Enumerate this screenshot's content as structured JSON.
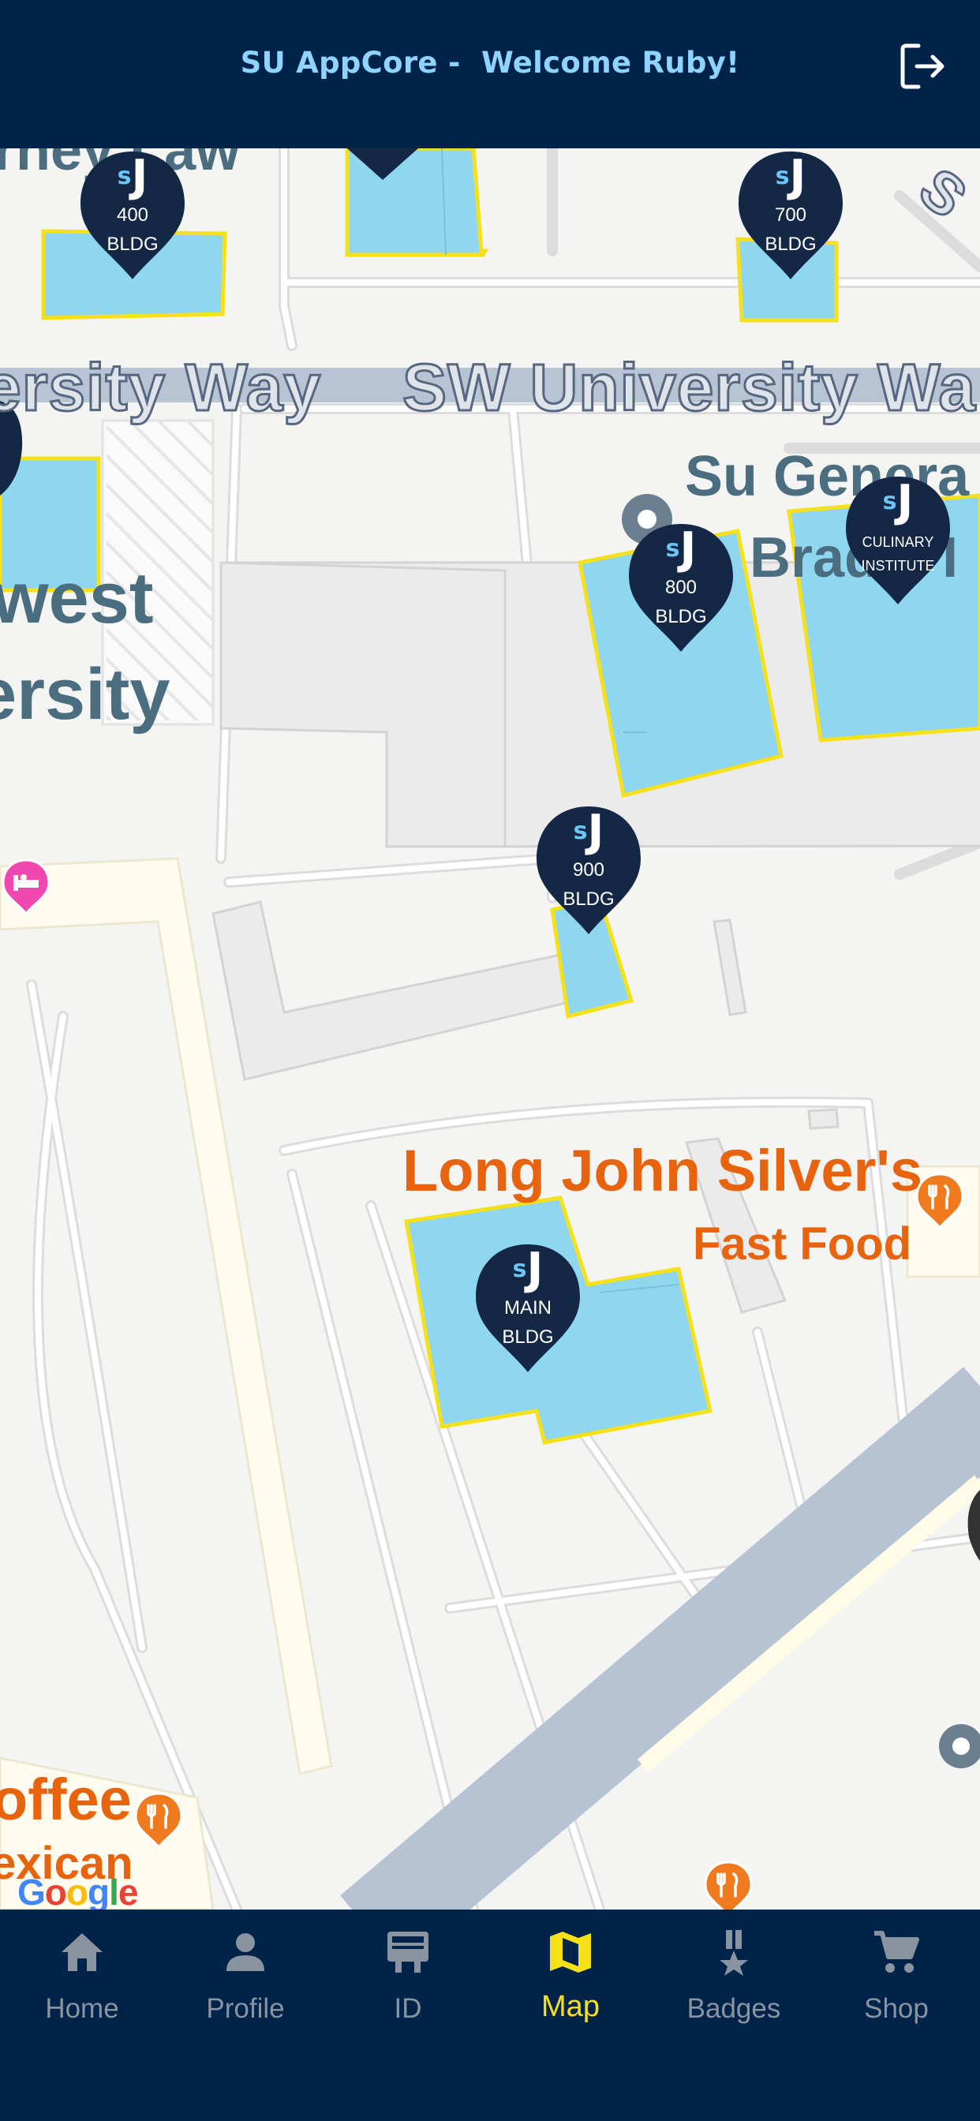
{
  "header": {
    "title": "SU AppCore -  Welcome Ruby!",
    "logout_icon": "logout-icon"
  },
  "map": {
    "streets": [
      "ersity Way",
      "SW University Wa"
    ],
    "labels": {
      "law": "rney Law",
      "west": "west",
      "ersity": "ersity",
      "su_general": "Su Genera",
      "bradley": "Brad   y I",
      "ljs": "Long John Silver's",
      "ljs_sub": "Fast Food",
      "coffee": "offee",
      "mexican": "exican",
      "google": "Google"
    },
    "pins": [
      {
        "id": "400",
        "line1": "400",
        "line2": "BLDG"
      },
      {
        "id": "700",
        "line1": "700",
        "line2": "BLDG"
      },
      {
        "id": "800",
        "line1": "800",
        "line2": "BLDG"
      },
      {
        "id": "culinary",
        "line1": "CULINARY",
        "line2": "INSTITUTE"
      },
      {
        "id": "900",
        "line1": "900",
        "line2": "BLDG"
      },
      {
        "id": "main",
        "line1": "MAIN",
        "line2": "BLDG"
      }
    ],
    "pin_logo": "J",
    "colors": {
      "building": "#8fd6f0",
      "building_outline": "#f5e11a",
      "pin": "#142846",
      "road": "#b5c3d3",
      "food_poi": "#f07b1e",
      "hotel_poi": "#f048b0"
    }
  },
  "nav": {
    "items": [
      {
        "label": "Home",
        "icon": "home-icon"
      },
      {
        "label": "Profile",
        "icon": "profile-icon"
      },
      {
        "label": "ID",
        "icon": "id-card-icon"
      },
      {
        "label": "Map",
        "icon": "map-icon",
        "active": true
      },
      {
        "label": "Badges",
        "icon": "badge-icon"
      },
      {
        "label": "Shop",
        "icon": "cart-icon"
      }
    ]
  }
}
